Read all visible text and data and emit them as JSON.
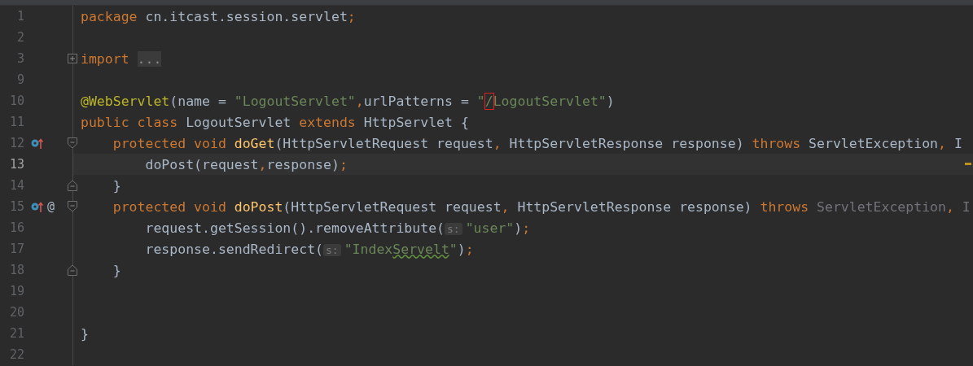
{
  "editor": {
    "lines": [
      {
        "number": "1",
        "current": false,
        "tokens": [
          {
            "kind": "keyword",
            "text": "package "
          },
          {
            "kind": "plain",
            "text": "cn.itcast.session.servlet"
          },
          {
            "kind": "keyword",
            "text": ";"
          }
        ]
      },
      {
        "number": "2",
        "current": false
      },
      {
        "number": "3",
        "current": false,
        "fold": {
          "kind": "expand"
        },
        "tokens": [
          {
            "kind": "keyword",
            "text": "import "
          },
          {
            "kind": "folded",
            "text": "..."
          }
        ]
      },
      {
        "number": "9",
        "current": false
      },
      {
        "number": "10",
        "current": false,
        "tokens": [
          {
            "kind": "annotation",
            "text": "@WebServlet"
          },
          {
            "kind": "plain",
            "text": "(name = "
          },
          {
            "kind": "string",
            "text": "\"LogoutServlet\""
          },
          {
            "kind": "keyword",
            "text": ","
          },
          {
            "kind": "plain",
            "text": "urlPatterns = "
          },
          {
            "kind": "string",
            "text": "\""
          },
          {
            "kind": "boxed",
            "text": "/"
          },
          {
            "kind": "string",
            "text": "LogoutServlet\""
          },
          {
            "kind": "plain",
            "text": ")"
          }
        ]
      },
      {
        "number": "11",
        "current": false,
        "tokens": [
          {
            "kind": "keyword",
            "text": "public class "
          },
          {
            "kind": "plain",
            "text": "LogoutServlet "
          },
          {
            "kind": "keyword",
            "text": "extends "
          },
          {
            "kind": "plain",
            "text": "HttpServlet {"
          }
        ]
      },
      {
        "number": "12",
        "current": false,
        "gutter_icons": [
          {
            "kind": "overrides"
          }
        ],
        "fold": {
          "kind": "start"
        },
        "tokens": [
          {
            "kind": "keyword",
            "text": "    protected void "
          },
          {
            "kind": "method",
            "text": "doGet"
          },
          {
            "kind": "plain",
            "text": "(HttpServletRequest request"
          },
          {
            "kind": "keyword",
            "text": ", "
          },
          {
            "kind": "plain",
            "text": "HttpServletResponse response) "
          },
          {
            "kind": "keyword",
            "text": "throws "
          },
          {
            "kind": "plain",
            "text": "ServletException"
          },
          {
            "kind": "keyword",
            "text": ", "
          },
          {
            "kind": "plain",
            "text": "I"
          }
        ]
      },
      {
        "number": "13",
        "current": true,
        "stripe_mark": true,
        "tokens": [
          {
            "kind": "plain",
            "text": "        doPost(request"
          },
          {
            "kind": "keyword",
            "text": ","
          },
          {
            "kind": "plain",
            "text": "response)"
          },
          {
            "kind": "keyword",
            "text": ";"
          }
        ]
      },
      {
        "number": "14",
        "current": false,
        "fold": {
          "kind": "end"
        },
        "tokens": [
          {
            "kind": "plain",
            "text": "    }"
          }
        ]
      },
      {
        "number": "15",
        "current": false,
        "gutter_icons": [
          {
            "kind": "overrides"
          }
        ],
        "gutter_mark": "@",
        "fold": {
          "kind": "start"
        },
        "tokens": [
          {
            "kind": "keyword",
            "text": "    protected void "
          },
          {
            "kind": "method",
            "text": "doPost"
          },
          {
            "kind": "plain",
            "text": "(HttpServletRequest request"
          },
          {
            "kind": "keyword",
            "text": ", "
          },
          {
            "kind": "plain",
            "text": "HttpServletResponse response) "
          },
          {
            "kind": "keyword",
            "text": "throws "
          },
          {
            "kind": "dim",
            "text": "ServletException"
          },
          {
            "kind": "keyword",
            "text": ", "
          },
          {
            "kind": "dim",
            "text": "I"
          }
        ]
      },
      {
        "number": "16",
        "current": false,
        "tokens": [
          {
            "kind": "plain",
            "text": "        request.getSession().removeAttribute("
          },
          {
            "kind": "hint",
            "text": "s:"
          },
          {
            "kind": "string",
            "text": "\"user\""
          },
          {
            "kind": "plain",
            "text": ")"
          },
          {
            "kind": "keyword",
            "text": ";"
          }
        ]
      },
      {
        "number": "17",
        "current": false,
        "tokens": [
          {
            "kind": "plain",
            "text": "        response.sendRedirect("
          },
          {
            "kind": "hint",
            "text": "s:"
          },
          {
            "kind": "string",
            "text": "\"Index"
          },
          {
            "kind": "typo",
            "text": "Servelt"
          },
          {
            "kind": "string",
            "text": "\""
          },
          {
            "kind": "plain",
            "text": ")"
          },
          {
            "kind": "keyword",
            "text": ";"
          }
        ]
      },
      {
        "number": "18",
        "current": false,
        "fold": {
          "kind": "end"
        },
        "tokens": [
          {
            "kind": "plain",
            "text": "    }"
          }
        ]
      },
      {
        "number": "19",
        "current": false
      },
      {
        "number": "20",
        "current": false
      },
      {
        "number": "21",
        "current": false,
        "tokens": [
          {
            "kind": "plain",
            "text": "}"
          }
        ]
      },
      {
        "number": "22",
        "current": false
      }
    ]
  }
}
